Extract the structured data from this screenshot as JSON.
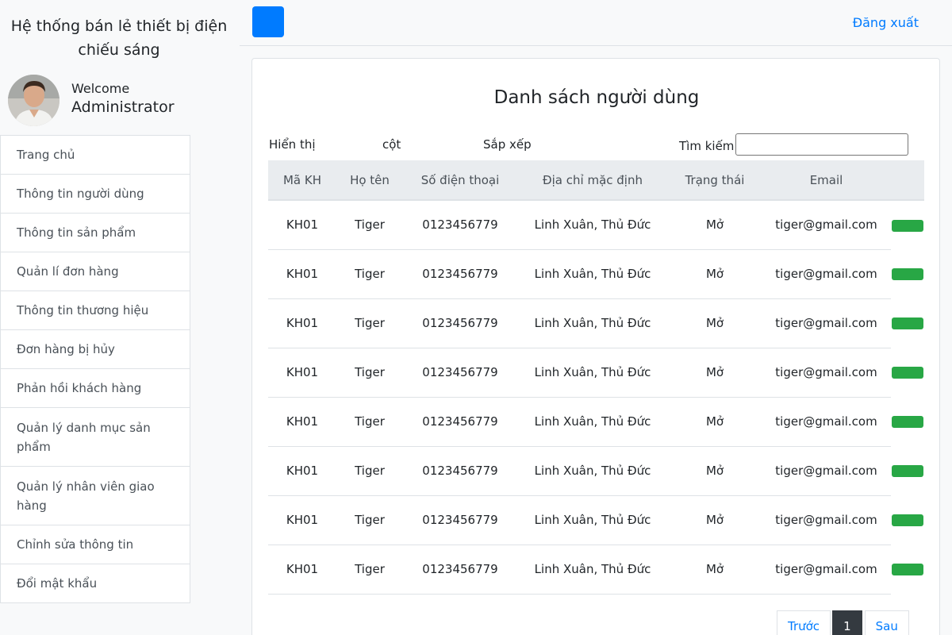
{
  "sidebar": {
    "brand_line1": "Hệ thống bán lẻ thiết bị điện",
    "brand_line2": "chiếu sáng",
    "welcome": "Welcome",
    "admin_name": "Administrator",
    "items": [
      {
        "label": "Trang chủ"
      },
      {
        "label": "Thông tin người dùng"
      },
      {
        "label": "Thông tin sản phẩm"
      },
      {
        "label": "Quản lí đơn hàng"
      },
      {
        "label": "Thông tin thương hiệu"
      },
      {
        "label": "Đơn hàng bị hủy"
      },
      {
        "label": "Phản hồi khách hàng"
      },
      {
        "label": "Quản lý danh mục sản phẩm"
      },
      {
        "label": "Quản lý nhân viên giao hàng"
      },
      {
        "label": "Chỉnh sửa thông tin"
      },
      {
        "label": "Đổi mật khẩu"
      }
    ]
  },
  "topbar": {
    "logout": "Đăng xuất",
    "toggle_color": "#007bff"
  },
  "main": {
    "title": "Danh sách người dùng",
    "controls": {
      "show": "Hiển thị",
      "columns": "cột",
      "sort": "Sắp xếp",
      "search": "Tìm kiếm",
      "search_value": ""
    },
    "table": {
      "headers": [
        "Mã KH",
        "Họ tên",
        "Số điện thoại",
        "Địa chỉ mặc định",
        "Trạng thái",
        "Email"
      ],
      "rows": [
        [
          "KH01",
          "Tiger",
          "0123456779",
          "Linh Xuân, Thủ Đức",
          "Mở",
          "tiger@gmail.com"
        ],
        [
          "KH01",
          "Tiger",
          "0123456779",
          "Linh Xuân, Thủ Đức",
          "Mở",
          "tiger@gmail.com"
        ],
        [
          "KH01",
          "Tiger",
          "0123456779",
          "Linh Xuân, Thủ Đức",
          "Mở",
          "tiger@gmail.com"
        ],
        [
          "KH01",
          "Tiger",
          "0123456779",
          "Linh Xuân, Thủ Đức",
          "Mở",
          "tiger@gmail.com"
        ],
        [
          "KH01",
          "Tiger",
          "0123456779",
          "Linh Xuân, Thủ Đức",
          "Mở",
          "tiger@gmail.com"
        ],
        [
          "KH01",
          "Tiger",
          "0123456779",
          "Linh Xuân, Thủ Đức",
          "Mở",
          "tiger@gmail.com"
        ],
        [
          "KH01",
          "Tiger",
          "0123456779",
          "Linh Xuân, Thủ Đức",
          "Mở",
          "tiger@gmail.com"
        ],
        [
          "KH01",
          "Tiger",
          "0123456779",
          "Linh Xuân, Thủ Đức",
          "Mở",
          "tiger@gmail.com"
        ]
      ],
      "action_color": "#28a745"
    },
    "pagination": {
      "prev": "Trước",
      "current": "1",
      "next": "Sau"
    }
  }
}
